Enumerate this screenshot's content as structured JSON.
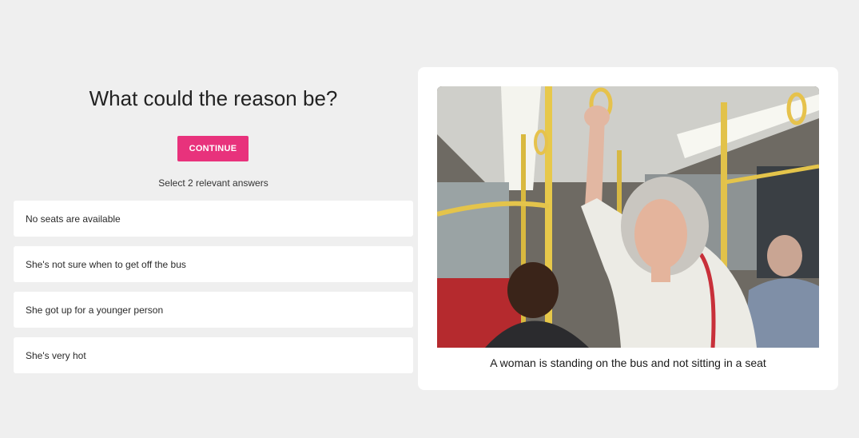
{
  "quiz": {
    "question": "What could the reason be?",
    "continue_label": "CONTINUE",
    "instruction": "Select 2 relevant answers",
    "answers": [
      "No seats are available",
      "She's not sure when to get off the bus",
      "She got up for a younger person",
      "She's very hot"
    ]
  },
  "image_card": {
    "caption": "A woman is standing on the bus and not sitting in a seat"
  },
  "colors": {
    "accent": "#e8327c",
    "background": "#efefef",
    "card": "#ffffff"
  }
}
